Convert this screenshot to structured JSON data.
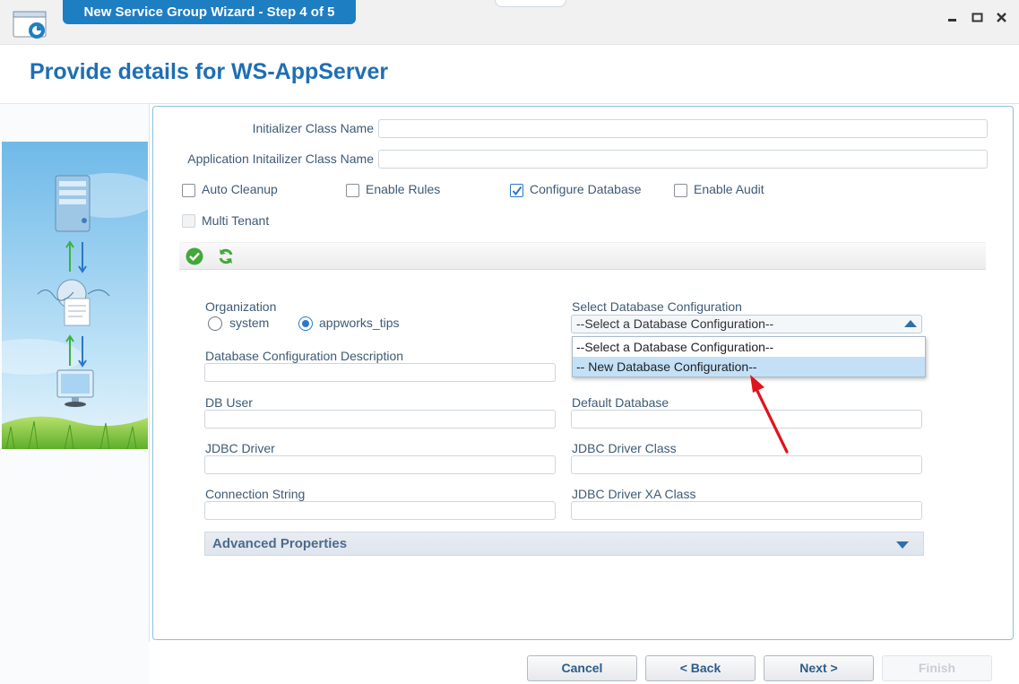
{
  "window": {
    "title": "New Service Group Wizard - Step 4 of 5",
    "controls": [
      "minimize-icon",
      "maximize-icon",
      "close-icon"
    ]
  },
  "page": {
    "title": "Provide details for WS-AppServer"
  },
  "form": {
    "initializer_class_label": "Initializer Class Name",
    "initializer_class_value": "",
    "app_initializer_class_label": "Application Initailizer Class Name",
    "app_initializer_class_value": "",
    "checkboxes": [
      {
        "label": "Auto Cleanup",
        "checked": false,
        "enabled": true
      },
      {
        "label": "Enable Rules",
        "checked": false,
        "enabled": true
      },
      {
        "label": "Configure Database",
        "checked": true,
        "enabled": true
      },
      {
        "label": "Enable Audit",
        "checked": false,
        "enabled": true
      },
      {
        "label": "Multi Tenant",
        "checked": false,
        "enabled": false
      }
    ],
    "toolbar_icons": [
      "check-circle-icon",
      "refresh-icon"
    ]
  },
  "database": {
    "organization_label": "Organization",
    "organization_options": [
      "system",
      "appworks_tips"
    ],
    "organization_selected": "appworks_tips",
    "select_config_label": "Select Database Configuration",
    "select_config_value": "--Select a Database Configuration--",
    "dropdown_options": [
      "--Select a Database Configuration--",
      "-- New Database Configuration--"
    ],
    "dropdown_highlighted": "-- New Database Configuration--",
    "description_label": "Database Configuration Description",
    "db_user_label": "DB User",
    "default_db_label": "Default Database",
    "jdbc_driver_label": "JDBC Driver",
    "jdbc_driver_class_label": "JDBC Driver Class",
    "connection_string_label": "Connection String",
    "jdbc_xa_class_label": "JDBC Driver XA Class",
    "advanced_label": "Advanced Properties"
  },
  "buttons": {
    "cancel": "Cancel",
    "back": "< Back",
    "next": "Next >",
    "finish": "Finish"
  },
  "colors": {
    "accent": "#1e7ec2",
    "title": "#1f6fb2",
    "annotation": "#e0141c"
  }
}
